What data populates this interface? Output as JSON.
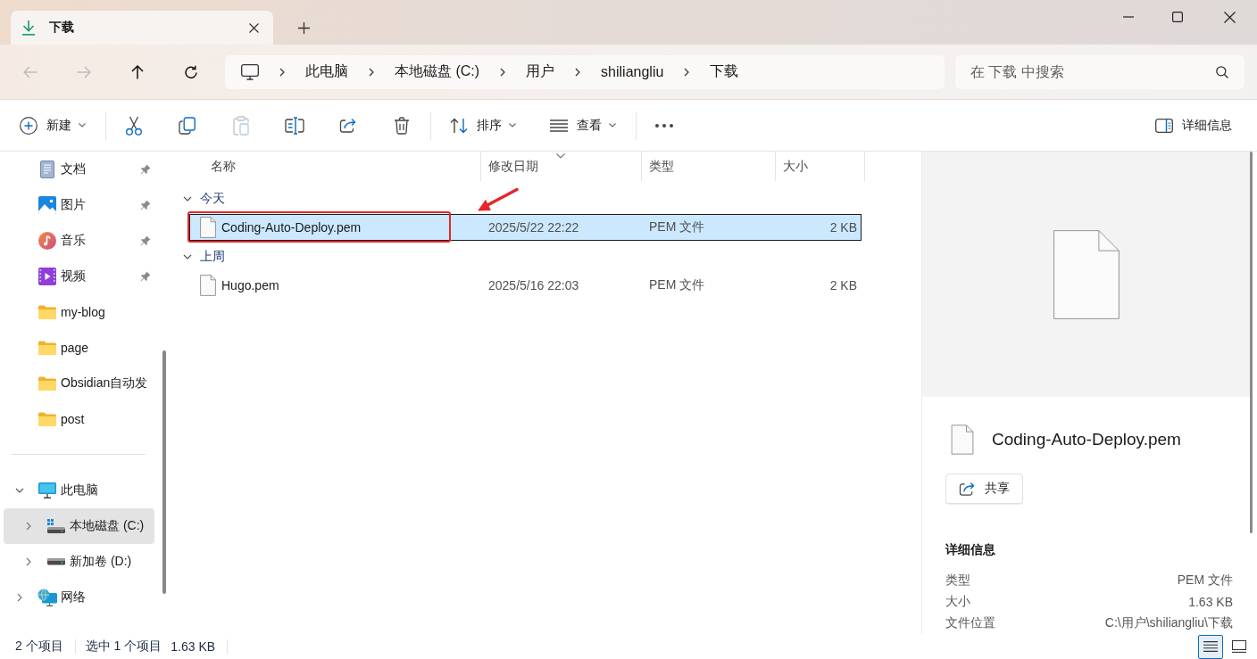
{
  "tabs": [
    {
      "title": "下载",
      "selected": true
    }
  ],
  "nav_buttons": [
    {
      "kind": "back",
      "disabled": true
    },
    {
      "kind": "forward",
      "disabled": true
    },
    {
      "kind": "up",
      "disabled": false
    },
    {
      "kind": "refresh",
      "disabled": false
    }
  ],
  "address_bar": {
    "crumbs": [
      "此电脑",
      "本地磁盘 (C:)",
      "用户",
      "shiliangliu",
      "下载"
    ]
  },
  "search": {
    "placeholder": "在 下载 中搜索"
  },
  "toolbar": {
    "groups": [
      [
        {
          "kind": "new",
          "label": "新建",
          "disabled": false
        }
      ],
      [
        {
          "kind": "cut",
          "disabled": false
        },
        {
          "kind": "copy",
          "disabled": false
        },
        {
          "kind": "paste",
          "disabled": true
        },
        {
          "kind": "rename",
          "disabled": false
        },
        {
          "kind": "share",
          "disabled": false
        },
        {
          "kind": "delete",
          "disabled": false
        }
      ],
      [
        {
          "kind": "sort",
          "label": "排序",
          "disabled": false
        },
        {
          "kind": "view",
          "label": "查看",
          "disabled": false
        }
      ],
      [
        {
          "kind": "more",
          "disabled": false
        }
      ]
    ],
    "details_button": {
      "label": "详细信息"
    }
  },
  "sidebar": {
    "quick_access": [
      {
        "kind": "documents",
        "label": "文档",
        "pinned": true,
        "selected": false
      },
      {
        "kind": "pictures",
        "label": "图片",
        "pinned": true,
        "selected": false
      },
      {
        "kind": "music",
        "label": "音乐",
        "pinned": true,
        "selected": false
      },
      {
        "kind": "videos",
        "label": "视频",
        "pinned": true,
        "selected": false
      },
      {
        "kind": "folder",
        "label": "my-blog",
        "pinned": false,
        "selected": false
      },
      {
        "kind": "folder",
        "label": "page",
        "pinned": false,
        "selected": false
      },
      {
        "kind": "folder",
        "label": "Obsidian自动发",
        "pinned": false,
        "selected": false
      },
      {
        "kind": "folder",
        "label": "post",
        "pinned": false,
        "selected": false
      }
    ],
    "tree": [
      {
        "kind": "pc",
        "label": "此电脑",
        "expanded": true,
        "selected": false,
        "children": [
          {
            "kind": "system_drive",
            "label": "本地磁盘 (C:)",
            "expanded": false,
            "selected": true
          },
          {
            "kind": "drive",
            "label": "新加卷 (D:)",
            "expanded": false,
            "selected": false
          }
        ]
      },
      {
        "kind": "network",
        "label": "网络",
        "expanded": false,
        "selected": false
      }
    ]
  },
  "file_list": {
    "columns": [
      {
        "label": "名称",
        "sorted": false
      },
      {
        "label": "修改日期",
        "sorted": true
      },
      {
        "label": "类型",
        "sorted": false
      },
      {
        "label": "大小",
        "sorted": false
      }
    ],
    "groups": [
      {
        "label": "今天",
        "expanded": true,
        "files": [
          {
            "name": "Coding-Auto-Deploy.pem",
            "modified": "2025/5/22 22:22",
            "type": "PEM 文件",
            "size": "2 KB",
            "selected": true,
            "highlighted": true
          }
        ]
      },
      {
        "label": "上周",
        "expanded": true,
        "files": [
          {
            "name": "Hugo.pem",
            "modified": "2025/5/16 22:03",
            "type": "PEM 文件",
            "size": "2 KB",
            "selected": false,
            "highlighted": false
          }
        ]
      }
    ]
  },
  "details_pane": {
    "file_name": "Coding-Auto-Deploy.pem",
    "share_button": "共享",
    "section_title": "详细信息",
    "properties": [
      {
        "label": "类型",
        "value": "PEM 文件"
      },
      {
        "label": "大小",
        "value": "1.63 KB"
      },
      {
        "label": "文件位置",
        "value": "C:\\用户\\shiliangliu\\下载"
      }
    ]
  },
  "status_bar": {
    "item_count": "2 个项目",
    "selection": "选中 1 个项目",
    "selection_size": "1.63 KB",
    "views": [
      {
        "kind": "details",
        "selected": true
      },
      {
        "kind": "tiles",
        "selected": false
      }
    ]
  }
}
